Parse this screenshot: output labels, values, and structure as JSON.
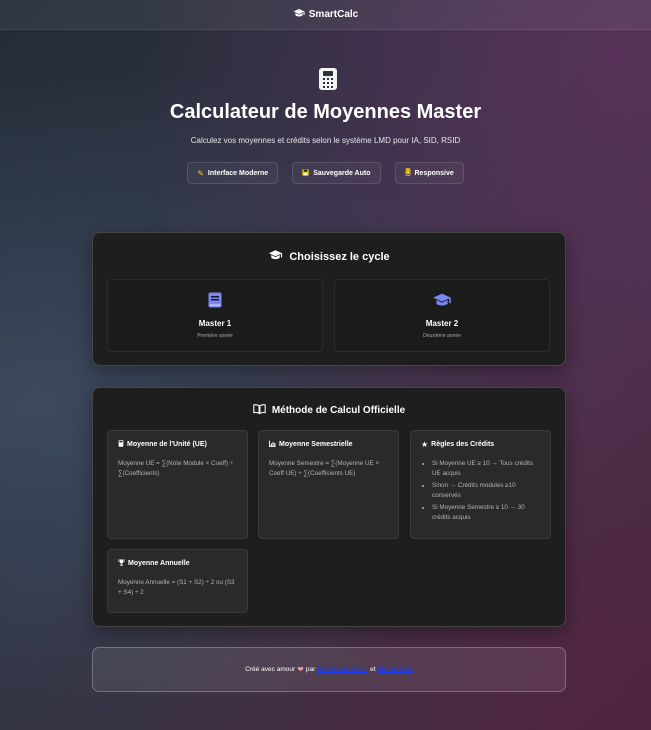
{
  "header": {
    "brand": "SmartCalc",
    "icon": "graduation-cap-icon"
  },
  "hero": {
    "icon": "calculator-icon",
    "title": "Calculateur de Moyennes Master",
    "subtitle": "Calculez vos moyennes et crédits selon le système LMD pour IA, SID, RSID",
    "chips": [
      {
        "icon": "pencil-icon",
        "label": "Interface Moderne"
      },
      {
        "icon": "floppy-disk-icon",
        "label": "Sauvegarde Auto"
      },
      {
        "icon": "mobile-phone-icon",
        "label": "Responsive"
      }
    ]
  },
  "cycle": {
    "title": "Choisissez le cycle",
    "options": [
      {
        "icon": "book-icon",
        "name": "Master 1",
        "desc": "Première année"
      },
      {
        "icon": "graduation-cap-icon",
        "name": "Master 2",
        "desc": "Deuxième année"
      }
    ]
  },
  "method": {
    "title": "Méthode de Calcul Officielle",
    "cards": [
      {
        "icon": "calculator-icon",
        "title": "Moyenne de l'Unité (UE)",
        "text": "Moyenne UE = ∑(Note Module × Coeff) ÷ ∑(Coefficients)"
      },
      {
        "icon": "bar-chart-icon",
        "title": "Moyenne Semestrielle",
        "text": "Moyenne Semestre = ∑(Moyenne UE × Coeff UE) ÷ ∑(Coefficients UE)"
      },
      {
        "icon": "star-icon",
        "title": "Règles des Crédits",
        "rules": [
          "Si Moyenne UE ≥ 10 → Tous crédits UE acquis",
          "Sinon → Crédits modules ≥10 conservés",
          "Si Moyenne Semestre ≥ 10 → 30 crédits acquis"
        ]
      },
      {
        "icon": "trophy-icon",
        "title": "Moyenne Annuelle",
        "text": "Moyenne Annuelle = (S1 + S2) ÷ 2 ou (S3 + S4) ÷ 2"
      }
    ]
  },
  "footer": {
    "prefix": "Créé avec amour",
    "by": "par",
    "author1": "Bekkouche Tayeb",
    "and": "et",
    "author2": "Bekkar Ilyes"
  }
}
